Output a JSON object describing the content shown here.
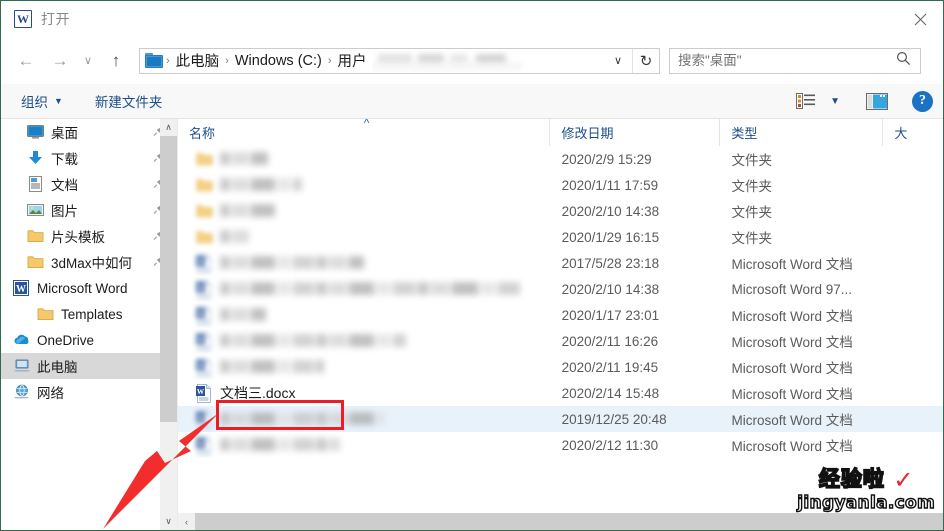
{
  "window": {
    "title": "打开",
    "app_icon": "word-icon",
    "close_label": "✕"
  },
  "navbar": {
    "back_icon": "←",
    "forward_icon": "→",
    "recent_icon": "∨",
    "up_icon": "↑",
    "breadcrumbs": [
      "此电脑",
      "Windows (C:)",
      "用户"
    ],
    "separator": "›",
    "dropdown_icon": "∨",
    "refresh_icon": "↻",
    "search_placeholder": "搜索\"桌面\"",
    "search_value": "",
    "search_icon": "search-icon"
  },
  "commandbar": {
    "organize_label": "组织",
    "organize_caret": "▼",
    "new_folder_label": "新建文件夹",
    "view_caret": "▼",
    "help_label": "?"
  },
  "navpane": {
    "items": [
      {
        "label": "桌面",
        "icon": "desktop-icon",
        "pinned": true,
        "indent": "sub",
        "selected": false
      },
      {
        "label": "下载",
        "icon": "download-icon",
        "pinned": true,
        "indent": "sub",
        "selected": false
      },
      {
        "label": "文档",
        "icon": "document-icon",
        "pinned": true,
        "indent": "sub",
        "selected": false
      },
      {
        "label": "图片",
        "icon": "pictures-icon",
        "pinned": true,
        "indent": "sub",
        "selected": false
      },
      {
        "label": "片头模板",
        "icon": "folder-icon",
        "pinned": true,
        "indent": "sub",
        "selected": false
      },
      {
        "label": "3dMax中如何",
        "icon": "folder-icon",
        "pinned": true,
        "indent": "sub",
        "selected": false
      },
      {
        "label": "Microsoft Word",
        "icon": "word-icon",
        "pinned": false,
        "indent": "root",
        "selected": false
      },
      {
        "label": "Templates",
        "icon": "folder-icon",
        "pinned": false,
        "indent": "sub2",
        "selected": false
      },
      {
        "label": "OneDrive",
        "icon": "onedrive-icon",
        "pinned": false,
        "indent": "root",
        "selected": false
      },
      {
        "label": "此电脑",
        "icon": "pc-icon",
        "pinned": false,
        "indent": "root",
        "selected": true
      },
      {
        "label": "网络",
        "icon": "network-icon",
        "pinned": false,
        "indent": "root",
        "selected": false
      }
    ],
    "scroll_up_icon": "∧",
    "scroll_down_icon": "∨"
  },
  "filelist": {
    "columns": [
      {
        "key": "name",
        "label": "名称",
        "sorted": true
      },
      {
        "key": "date",
        "label": "修改日期",
        "sorted": false
      },
      {
        "key": "type",
        "label": "类型",
        "sorted": false
      },
      {
        "key": "size",
        "label": "大",
        "sorted": false
      }
    ],
    "rows": [
      {
        "name": "",
        "blurred": true,
        "blur_width": 48,
        "icon": "folder-icon",
        "date": "2020/2/9 15:29",
        "type": "文件夹",
        "size": "",
        "selected": false,
        "highlighted": false
      },
      {
        "name": "",
        "blurred": true,
        "blur_width": 82,
        "icon": "folder-icon",
        "date": "2020/1/11 17:59",
        "type": "文件夹",
        "size": "",
        "selected": false,
        "highlighted": false
      },
      {
        "name": "",
        "blurred": true,
        "blur_width": 55,
        "icon": "folder-icon",
        "date": "2020/2/10 14:38",
        "type": "文件夹",
        "size": "",
        "selected": false,
        "highlighted": false
      },
      {
        "name": "",
        "blurred": true,
        "blur_width": 30,
        "icon": "folder-icon",
        "date": "2020/1/29 16:15",
        "type": "文件夹",
        "size": "",
        "selected": false,
        "highlighted": false
      },
      {
        "name": "",
        "blurred": true,
        "blur_width": 144,
        "icon": "docx-icon",
        "date": "2017/5/28 23:18",
        "type": "Microsoft Word 文档",
        "size": "",
        "selected": false,
        "highlighted": false
      },
      {
        "name": "",
        "blurred": true,
        "blur_width": 300,
        "icon": "docx-icon",
        "date": "2020/2/10 14:38",
        "type": "Microsoft Word 97...",
        "size": "",
        "selected": false,
        "highlighted": false
      },
      {
        "name": "",
        "blurred": true,
        "blur_width": 46,
        "icon": "docx-icon",
        "date": "2020/1/17 23:01",
        "type": "Microsoft Word 文档",
        "size": "",
        "selected": false,
        "highlighted": false
      },
      {
        "name": "",
        "blurred": true,
        "blur_width": 186,
        "icon": "docx-icon",
        "date": "2020/2/11 16:26",
        "type": "Microsoft Word 文档",
        "size": "",
        "selected": false,
        "highlighted": false
      },
      {
        "name": "",
        "blurred": true,
        "blur_width": 104,
        "icon": "docx-icon",
        "date": "2020/2/11 19:45",
        "type": "Microsoft Word 文档",
        "size": "",
        "selected": false,
        "highlighted": false
      },
      {
        "name": "文档三.docx",
        "blurred": false,
        "blur_width": 0,
        "icon": "docx-icon",
        "date": "2020/2/14 15:48",
        "type": "Microsoft Word 文档",
        "size": "",
        "selected": false,
        "highlighted": true
      },
      {
        "name": "",
        "blurred": true,
        "blur_width": 165,
        "icon": "docx-icon",
        "date": "2019/12/25 20:48",
        "type": "Microsoft Word 文档",
        "size": "",
        "selected": true,
        "highlighted": false
      },
      {
        "name": "",
        "blurred": true,
        "blur_width": 120,
        "icon": "docx-icon",
        "date": "2020/2/12 11:30",
        "type": "Microsoft Word 文档",
        "size": "",
        "selected": false,
        "highlighted": false
      }
    ],
    "hscroll_left_icon": "‹",
    "hscroll_right_icon": "›"
  },
  "annotations": {
    "highlight_box_color": "#ee1c25",
    "arrow_color": "#f22d2d",
    "watermark_cn": "经验啦",
    "watermark_check": "✓",
    "watermark_en": "jingyanla.com"
  }
}
